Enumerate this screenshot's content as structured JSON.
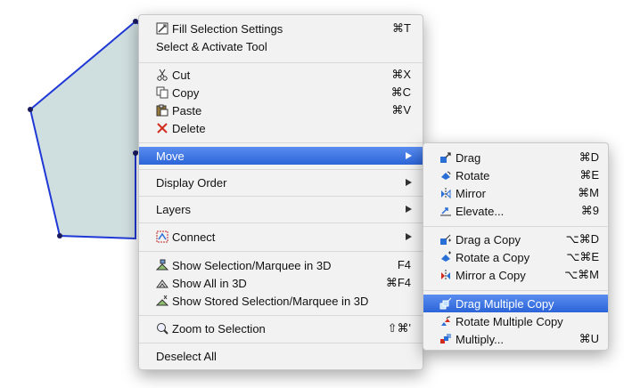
{
  "canvas": {
    "fill_color": "#cfdedf",
    "stroke_color": "#1f38d6"
  },
  "main_menu": {
    "fill_selection_settings": {
      "label": "Fill Selection Settings",
      "shortcut": "⌘T",
      "icon": "fill-settings-icon"
    },
    "select_activate_tool": {
      "label": "Select & Activate Tool"
    },
    "cut": {
      "label": "Cut",
      "shortcut": "⌘X",
      "icon": "scissors-icon"
    },
    "copy": {
      "label": "Copy",
      "shortcut": "⌘C",
      "icon": "copy-icon"
    },
    "paste": {
      "label": "Paste",
      "shortcut": "⌘V",
      "icon": "paste-icon"
    },
    "delete": {
      "label": "Delete",
      "icon": "delete-x-icon",
      "icon_color": "#d22a1e"
    },
    "move": {
      "label": "Move"
    },
    "display_order": {
      "label": "Display Order"
    },
    "layers": {
      "label": "Layers"
    },
    "connect": {
      "label": "Connect",
      "icon": "connect-icon"
    },
    "show_selection_3d": {
      "label": "Show Selection/Marquee in 3D",
      "shortcut": "F4",
      "icon": "show-3d-icon"
    },
    "show_all_3d": {
      "label": "Show All in 3D",
      "shortcut": "⌘F4",
      "icon": "show-all-3d-icon"
    },
    "show_stored_3d": {
      "label": "Show Stored Selection/Marquee in 3D",
      "icon": "show-stored-3d-icon"
    },
    "zoom_to_selection": {
      "label": "Zoom to Selection",
      "shortcut": "⇧⌘'",
      "icon": "zoom-icon"
    },
    "deselect_all": {
      "label": "Deselect All"
    }
  },
  "move_submenu": {
    "drag": {
      "label": "Drag",
      "shortcut": "⌘D",
      "icon": "drag-icon"
    },
    "rotate": {
      "label": "Rotate",
      "shortcut": "⌘E",
      "icon": "rotate-icon"
    },
    "mirror": {
      "label": "Mirror",
      "shortcut": "⌘M",
      "icon": "mirror-icon"
    },
    "elevate": {
      "label": "Elevate...",
      "shortcut": "⌘9",
      "icon": "elevate-icon"
    },
    "drag_copy": {
      "label": "Drag a Copy",
      "shortcut": "⌥⌘D",
      "icon": "drag-copy-icon"
    },
    "rotate_copy": {
      "label": "Rotate a Copy",
      "shortcut": "⌥⌘E",
      "icon": "rotate-copy-icon"
    },
    "mirror_copy": {
      "label": "Mirror a Copy",
      "shortcut": "⌥⌘M",
      "icon": "mirror-copy-icon"
    },
    "drag_multiple_copy": {
      "label": "Drag Multiple Copy",
      "icon": "drag-multiple-copy-icon"
    },
    "rotate_multiple_copy": {
      "label": "Rotate Multiple Copy",
      "icon": "rotate-multiple-copy-icon"
    },
    "multiply": {
      "label": "Multiply...",
      "shortcut": "⌘U",
      "icon": "multiply-icon"
    }
  },
  "colors": {
    "highlight": "#3a72e0",
    "menu_bg": "#f2f2f2",
    "icon_blue": "#2a6fd6"
  }
}
